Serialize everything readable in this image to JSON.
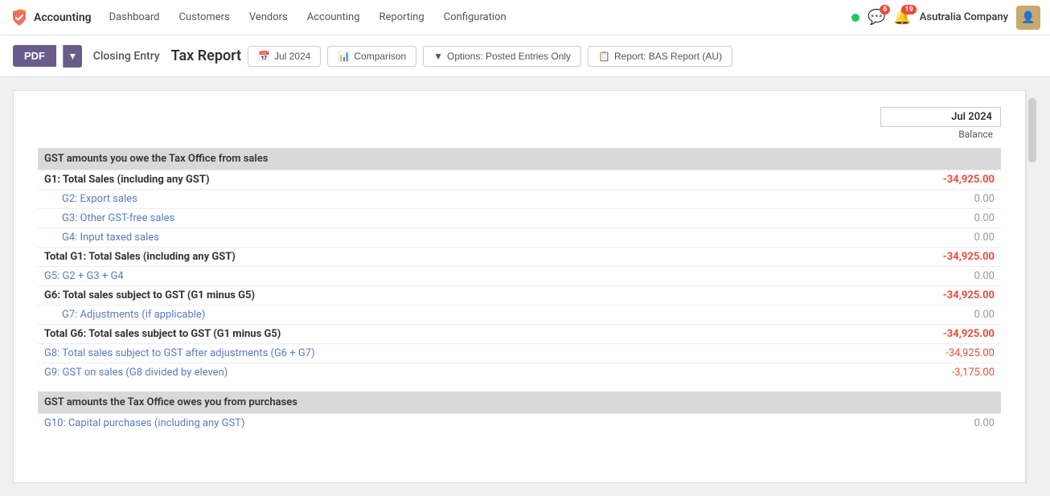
{
  "brand": {
    "name": "Accounting"
  },
  "nav": {
    "items": [
      {
        "label": "Dashboard",
        "id": "dashboard"
      },
      {
        "label": "Customers",
        "id": "customers"
      },
      {
        "label": "Vendors",
        "id": "vendors"
      },
      {
        "label": "Accounting",
        "id": "accounting"
      },
      {
        "label": "Reporting",
        "id": "reporting"
      },
      {
        "label": "Configuration",
        "id": "configuration"
      }
    ]
  },
  "nav_right": {
    "status_dot_color": "#22c55e",
    "notif1_count": "6",
    "notif2_count": "19",
    "company": "Asutralia Company"
  },
  "toolbar": {
    "pdf_label": "PDF",
    "closing_entry_label": "Closing Entry",
    "page_title": "Tax Report",
    "date_btn": "Jul 2024",
    "comparison_btn": "Comparison",
    "options_btn": "Options: Posted Entries Only",
    "report_btn": "Report: BAS Report (AU)"
  },
  "report": {
    "period": "Jul 2024",
    "balance_label": "Balance",
    "sections": [
      {
        "id": "section1",
        "header": "GST amounts you owe the Tax Office from sales",
        "rows": [
          {
            "id": "g1",
            "label": "G1: Total Sales (including any GST)",
            "amount": "-34,925.00",
            "type": "bold"
          },
          {
            "id": "g2",
            "label": "G2: Export sales",
            "amount": "0.00",
            "type": "link-indented"
          },
          {
            "id": "g3",
            "label": "G3: Other GST-free sales",
            "amount": "0.00",
            "type": "link-indented"
          },
          {
            "id": "g4",
            "label": "G4: Input taxed sales",
            "amount": "0.00",
            "type": "link-indented"
          },
          {
            "id": "total_g1",
            "label": "Total G1: Total Sales (including any GST)",
            "amount": "-34,925.00",
            "type": "bold"
          },
          {
            "id": "g5",
            "label": "G5: G2 + G3 + G4",
            "amount": "0.00",
            "type": "link"
          },
          {
            "id": "g6",
            "label": "G6: Total sales subject to GST (G1 minus G5)",
            "amount": "-34,925.00",
            "type": "bold"
          },
          {
            "id": "g7",
            "label": "G7: Adjustments (if applicable)",
            "amount": "0.00",
            "type": "link-indented"
          },
          {
            "id": "total_g6",
            "label": "Total G6: Total sales subject to GST (G1 minus G5)",
            "amount": "-34,925.00",
            "type": "bold"
          },
          {
            "id": "g8",
            "label": "G8: Total sales subject to GST after adjustments (G6 + G7)",
            "amount": "-34,925.00",
            "type": "link"
          },
          {
            "id": "g9",
            "label": "G9: GST on sales (G8 divided by eleven)",
            "amount": "-3,175.00",
            "type": "link"
          }
        ]
      },
      {
        "id": "section2",
        "header": "GST amounts the Tax Office owes you from purchases",
        "rows": [
          {
            "id": "g10",
            "label": "G10: Capital purchases (including any GST)",
            "amount": "0.00",
            "type": "link"
          }
        ]
      }
    ]
  }
}
